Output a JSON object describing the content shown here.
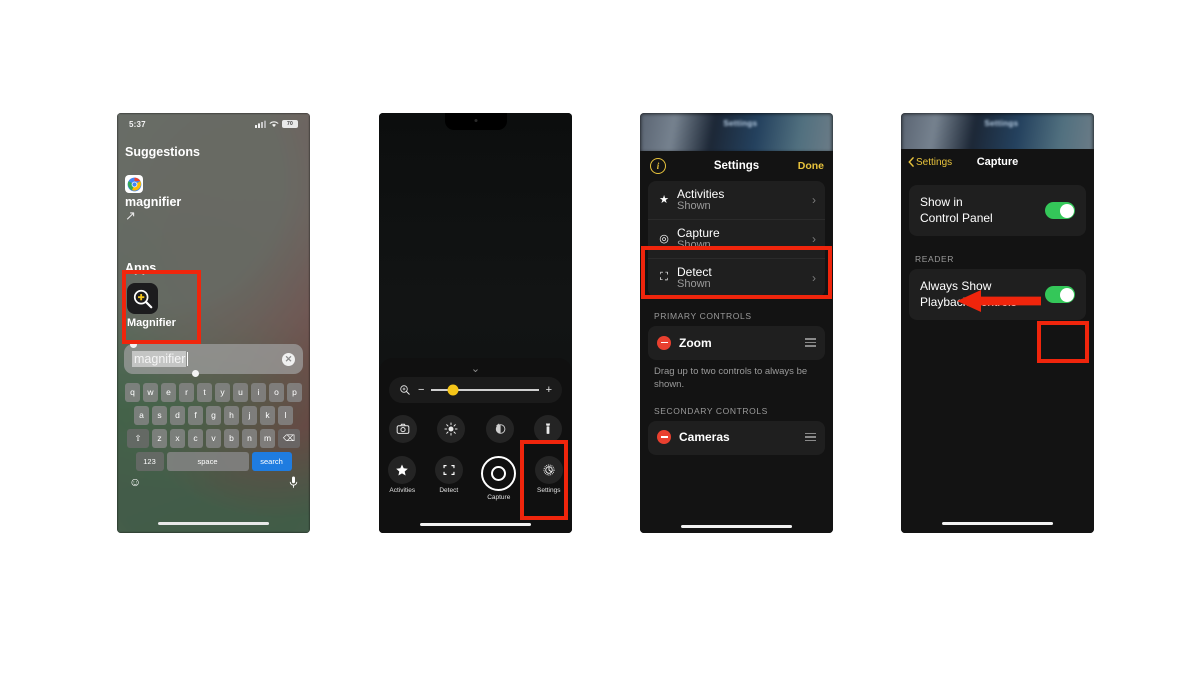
{
  "page": {
    "background": "#ffffff",
    "accent_red": "#f0250c",
    "accent_yellow": "#e8c33c",
    "accent_green": "#34c759",
    "accent_blue": "#1f7ce0"
  },
  "phone1": {
    "status": {
      "time": "5:37",
      "battery": "70",
      "cellular_icon": "cellular-icon",
      "wifi_icon": "wifi-icon"
    },
    "suggestions_header": "Suggestions",
    "suggestion": {
      "icon": "chrome-icon",
      "text": "magnifier",
      "arrow": "↗"
    },
    "apps_header": "Apps",
    "app": {
      "icon": "magnifier-app-icon",
      "label": "Magnifier"
    },
    "search": {
      "value": "magnifier",
      "clear_icon": "clear-icon"
    },
    "keyboard": {
      "row1": [
        "q",
        "w",
        "e",
        "r",
        "t",
        "y",
        "u",
        "i",
        "o",
        "p"
      ],
      "row2": [
        "a",
        "s",
        "d",
        "f",
        "g",
        "h",
        "j",
        "k",
        "l"
      ],
      "row3": [
        "z",
        "x",
        "c",
        "v",
        "b",
        "n",
        "m"
      ],
      "shift": "⇧",
      "backspace": "⌫",
      "numbers": "123",
      "space": "space",
      "search": "search",
      "emoji": "emoji-icon",
      "mic": "microphone-icon"
    }
  },
  "phone2": {
    "zoom": {
      "icon": "magnifier-zoom-icon",
      "minus": "−",
      "plus": "+",
      "value_percent": 20
    },
    "controls_row1": [
      {
        "name": "camera-icon",
        "glyph": "camera"
      },
      {
        "name": "brightness-icon",
        "glyph": "brightness"
      },
      {
        "name": "contrast-icon",
        "glyph": "contrast"
      },
      {
        "name": "flashlight-icon",
        "glyph": "flashlight"
      }
    ],
    "controls_row2": [
      {
        "label": "Activities",
        "icon": "star-icon"
      },
      {
        "label": "Detect",
        "icon": "detect-frame-icon"
      },
      {
        "label": "Capture",
        "icon": "capture-shutter-icon"
      },
      {
        "label": "Settings",
        "icon": "gear-icon"
      }
    ],
    "highlight": "Settings"
  },
  "phone3": {
    "blurred_bg_text": "Settings",
    "navbar": {
      "info_icon": "info-icon",
      "title": "Settings",
      "done": "Done"
    },
    "list": [
      {
        "icon": "star-icon",
        "title": "Activities",
        "subtitle": "Shown",
        "chevron": "›"
      },
      {
        "icon": "capture-target-icon",
        "title": "Capture",
        "subtitle": "Shown",
        "chevron": "›",
        "highlighted": true
      },
      {
        "icon": "detect-frame-icon",
        "title": "Detect",
        "subtitle": "Shown",
        "chevron": "›"
      }
    ],
    "primary_header": "PRIMARY CONTROLS",
    "primary_items": [
      {
        "label": "Zoom",
        "remove_icon": "remove-icon",
        "drag_icon": "drag-handle-icon"
      }
    ],
    "hint": "Drag up to two controls to always be shown.",
    "secondary_header": "SECONDARY CONTROLS",
    "secondary_items": [
      {
        "label": "Cameras",
        "remove_icon": "remove-icon",
        "drag_icon": "drag-handle-icon"
      }
    ]
  },
  "phone4": {
    "blurred_bg_text": "Settings",
    "navbar": {
      "back_label": "Settings",
      "back_icon": "chevron-left-icon",
      "title": "Capture"
    },
    "group1": [
      {
        "label": "Show in\nControl Panel",
        "toggle": "on"
      }
    ],
    "reader_header": "READER",
    "group2": [
      {
        "label": "Always Show\nPlayback Controls",
        "toggle": "on",
        "highlighted": true
      }
    ],
    "arrow": "left-arrow-annotation"
  }
}
